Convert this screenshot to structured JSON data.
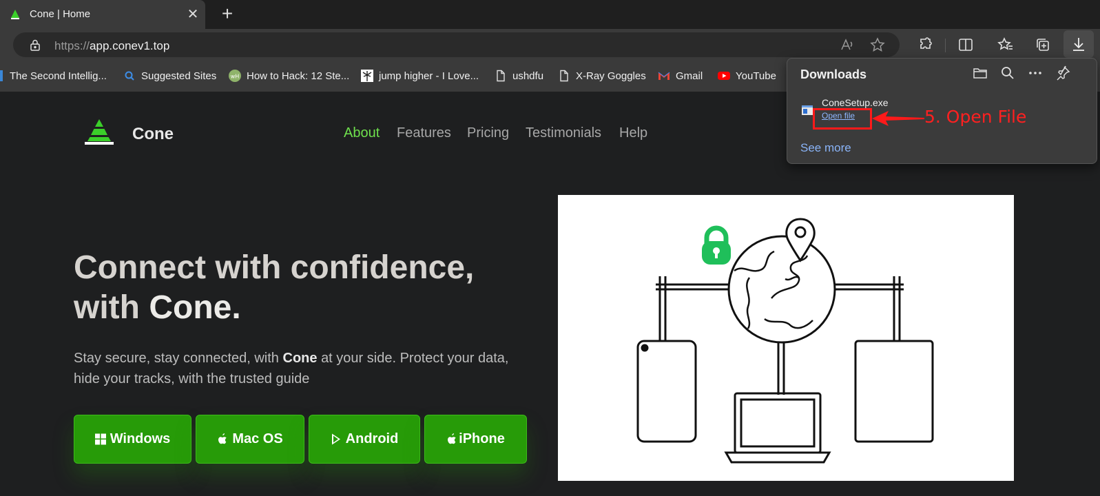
{
  "browser": {
    "tab_title": "Cone | Home",
    "url_scheme": "https://",
    "url_host": "app.conev1.top",
    "bookmarks": [
      {
        "label": "The Second Intellig...",
        "icon": "page-icon"
      },
      {
        "label": "Suggested Sites",
        "icon": "search-icon"
      },
      {
        "label": "How to Hack: 12 Ste...",
        "icon": "wikihow-icon"
      },
      {
        "label": "jump higher - I Love...",
        "icon": "palm-icon"
      },
      {
        "label": "ushdfu",
        "icon": "page-icon"
      },
      {
        "label": "X-Ray Goggles",
        "icon": "page-icon"
      },
      {
        "label": "Gmail",
        "icon": "gmail-icon"
      },
      {
        "label": "YouTube",
        "icon": "youtube-icon"
      }
    ]
  },
  "downloads": {
    "title": "Downloads",
    "file_name": "ConeSetup.exe",
    "open_label": "Open file",
    "see_more": "See more"
  },
  "annotation": {
    "text": "5. Open File",
    "color": "#ff2020"
  },
  "site": {
    "brand": "Cone",
    "nav": [
      "About",
      "Features",
      "Pricing",
      "Testimonials",
      "Help"
    ],
    "hero_line1": "Connect with confidence,",
    "hero_line2_prefix": "with",
    "hero_line2_brand": "Cone.",
    "sub_part1": "Stay secure, stay connected, with",
    "sub_brand": "Cone",
    "sub_part2": "at your side. Protect your data, hide your tracks, with the trusted guide",
    "buttons": [
      "Windows",
      "Mac OS",
      "Android",
      "iPhone"
    ],
    "accent": "#6fe04d",
    "button_color": "#279b08"
  }
}
